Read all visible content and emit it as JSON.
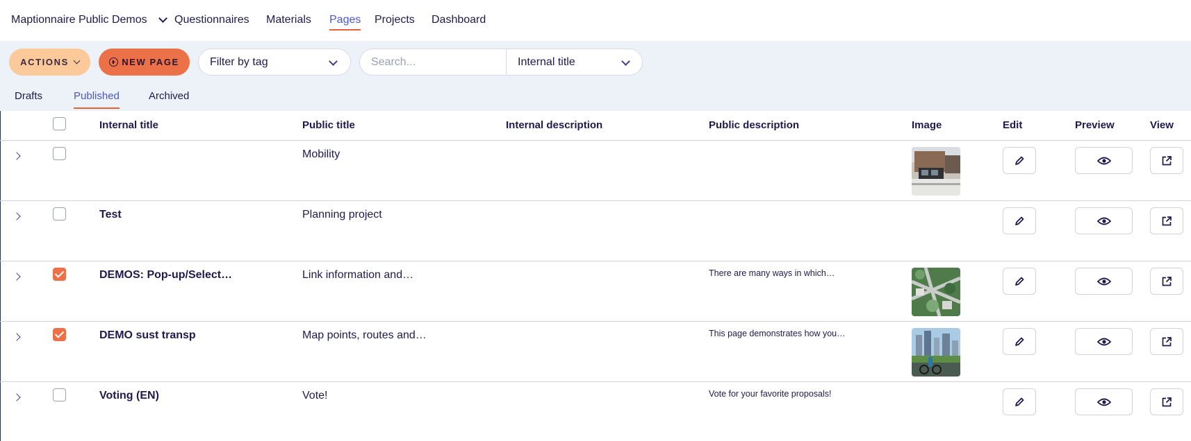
{
  "nav": {
    "brand": "Maptionnaire Public Demos",
    "links": [
      "Questionnaires",
      "Materials",
      "Pages",
      "Projects",
      "Dashboard"
    ],
    "active": "Pages"
  },
  "toolbar": {
    "actions_label": "ACTIONS",
    "new_page_label": "NEW PAGE",
    "tag_filter_value": "Filter by tag",
    "search_placeholder": "Search...",
    "search_field_value": "Internal title"
  },
  "tabs": [
    "Drafts",
    "Published",
    "Archived"
  ],
  "active_tab": "Published",
  "table": {
    "headers": {
      "internal_title": "Internal title",
      "public_title": "Public title",
      "internal_description": "Internal description",
      "public_description": "Public description",
      "image": "Image",
      "edit": "Edit",
      "preview": "Preview",
      "view": "View"
    },
    "rows": [
      {
        "internal_title": "",
        "public_title": "Mobility",
        "internal_description": "",
        "public_description": "",
        "checked": false,
        "image": "street-building-photo"
      },
      {
        "internal_title": "Test",
        "public_title": "Planning project",
        "internal_description": "",
        "public_description": "",
        "checked": false,
        "image": ""
      },
      {
        "internal_title": "DEMOS: Pop-up/Select…",
        "public_title": "Link information and…",
        "internal_description": "",
        "public_description": "There are many ways in which…",
        "checked": true,
        "image": "aerial-city-photo"
      },
      {
        "internal_title": "DEMO sust transp",
        "public_title": "Map points, routes and…",
        "internal_description": "",
        "public_description": "This page demonstrates how you…",
        "checked": true,
        "image": "cyclist-city-photo"
      },
      {
        "internal_title": "Voting (EN)",
        "public_title": "Vote!",
        "internal_description": "",
        "public_description": "Vote for your favorite proposals!",
        "checked": false,
        "image": ""
      }
    ]
  },
  "colors": {
    "accent": "#4a56c9",
    "orange": "#ec7048",
    "peach": "#fbc99a",
    "band": "#edf2f8",
    "text": "#1f1a4d"
  }
}
